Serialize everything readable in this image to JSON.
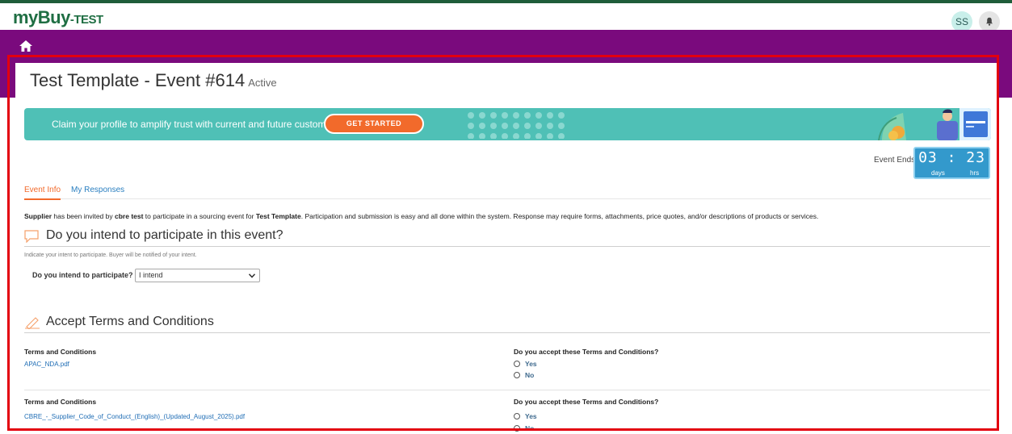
{
  "app": {
    "logo_main": "myBuy",
    "logo_suffix": "-TEST",
    "avatar": "SS"
  },
  "icons": {
    "notification": "bell-icon",
    "home": "home-icon",
    "participate_section": "chat-bubble-icon",
    "terms_section": "pen-icon",
    "dropdown": "chevron-down-icon"
  },
  "colors": {
    "accent": "#f26a2b",
    "purple_band": "#7a0a7d",
    "brand_green": "#1f6e43",
    "banner": "#4fc0b6",
    "timer": "#3399cc",
    "link": "#1f6db5",
    "highlight_frame": "#e3000f"
  },
  "page": {
    "title": "Test Template - Event #614",
    "status": "Active"
  },
  "banner": {
    "text": "Claim your profile to amplify trust with current and future customers.",
    "button": "GET STARTED"
  },
  "timer": {
    "label": "Event Ends",
    "digits": "03 : 23",
    "days_label": "days",
    "hrs_label": "hrs"
  },
  "tabs": [
    {
      "label": "Event Info",
      "active": true
    },
    {
      "label": "My Responses",
      "active": false
    }
  ],
  "intro": {
    "bold1": "Supplier",
    "t1": " has been invited by ",
    "bold2": "cbre test",
    "t2": " to participate in a sourcing event for ",
    "bold3": "Test Template",
    "t3": ". Participation and submission is easy and all done within the system. Response may require forms, attachments, price quotes, and/or descriptions of products or services."
  },
  "participate": {
    "title": "Do you intend to participate in this event?",
    "hint": "Indicate your intent to participate. Buyer will be notified of your intent.",
    "question": "Do you intend to participate?",
    "selected": "I intend"
  },
  "terms": {
    "title": "Accept Terms and Conditions",
    "rows": [
      {
        "label": "Terms and Conditions",
        "file": "APAC_NDA.pdf",
        "question": "Do you accept these Terms and Conditions?",
        "yes": "Yes",
        "no": "No"
      },
      {
        "label": "Terms and Conditions",
        "file": "CBRE_-_Supplier_Code_of_Conduct_(English)_(Updated_August_2025).pdf",
        "question": "Do you accept these Terms and Conditions?",
        "yes": "Yes",
        "no": "No"
      }
    ]
  }
}
